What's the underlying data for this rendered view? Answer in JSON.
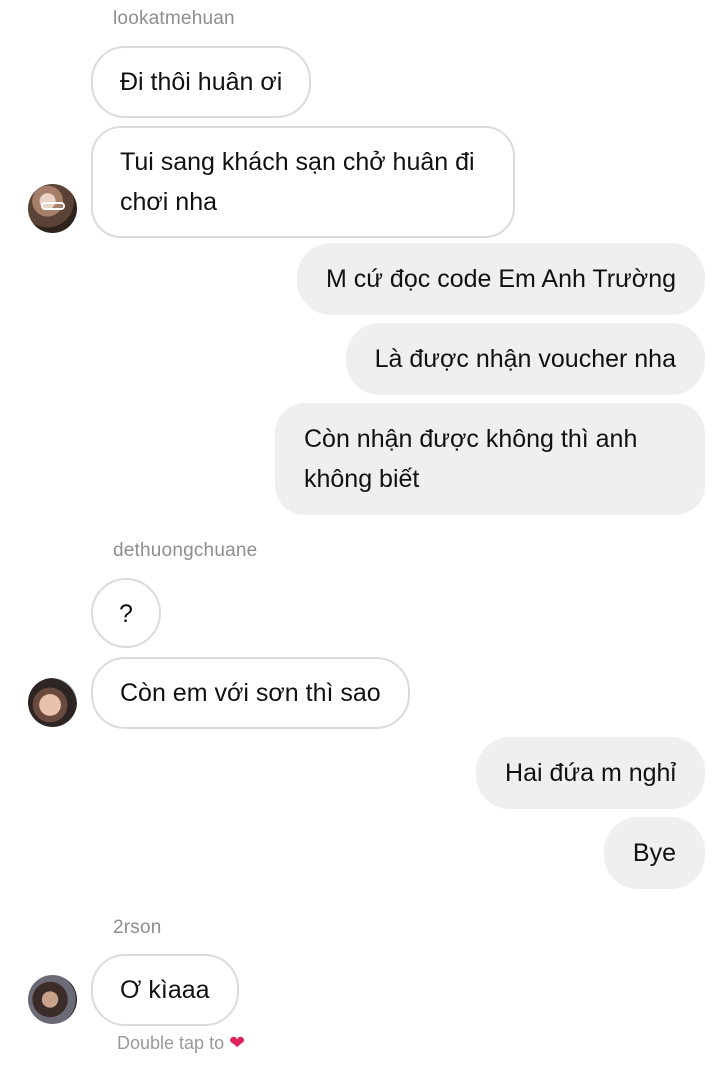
{
  "thread": [
    {
      "sender": "lookatmehuan",
      "messages": [
        "Đi thôi huân ơi",
        "Tui sang khách sạn chở huân đi chơi nha"
      ]
    },
    {
      "sender": "me",
      "messages": [
        "M cứ đọc code Em Anh Trường",
        "Là được nhận  voucher nha",
        "Còn nhận được không thì anh không biết"
      ]
    },
    {
      "sender": "dethuongchuane",
      "messages": [
        "?",
        "Còn em với sơn thì sao"
      ]
    },
    {
      "sender": "me",
      "messages": [
        "Hai đứa m nghỉ",
        "Bye"
      ]
    },
    {
      "sender": "2rson",
      "messages": [
        "Ơ kìaaa"
      ]
    }
  ],
  "footer": {
    "hint": "Double tap to",
    "reaction_icon": "heart-icon"
  },
  "colors": {
    "incoming_border": "#dbdbdb",
    "outgoing_bg": "#efefef",
    "heart": "#e0245e"
  }
}
